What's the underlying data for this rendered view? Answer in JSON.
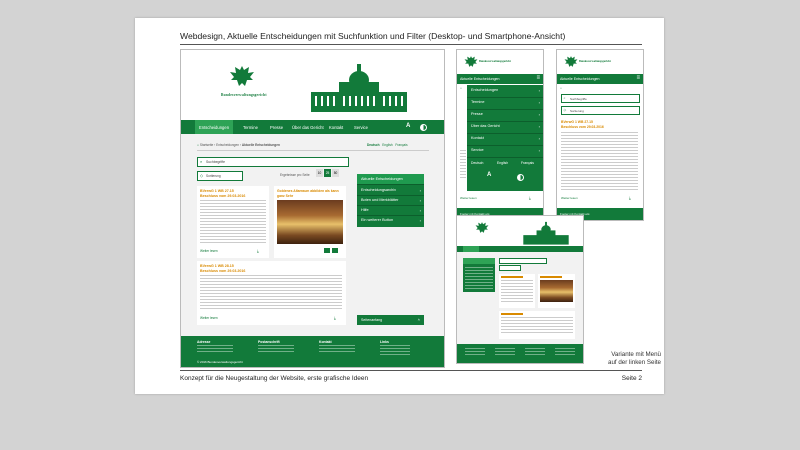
{
  "slide": {
    "title": "Webdesign, Aktuelle Entscheidungen mit Suchfunktion und Filter (Desktop- und Smartphone-Ansicht)",
    "footer_left": "Konzept für die Neugestaltung der Website, erste grafische Ideen",
    "footer_right": "Seite 2",
    "caption_line1": "Variante mit Menü",
    "caption_line2": "auf der linken Seite"
  },
  "colors": {
    "brand": "#127a3a",
    "accent": "#d98a00",
    "background": "#d3d3d3"
  },
  "desktop": {
    "logo_text": "Bundesverwaltungsgericht",
    "nav": [
      "Entscheidungen",
      "Termine",
      "Presse",
      "Über das Gericht",
      "Kontakt",
      "Service"
    ],
    "breadcrumb": [
      "Startseite",
      "Entscheidungen",
      "Aktuelle Entscheidungen"
    ],
    "languages": [
      "Deutsch",
      "English",
      "Français"
    ],
    "search_placeholder": "Suchbegriffe",
    "filter_label": "Sortierung",
    "per_page_label": "Ergebnisse pro Seite",
    "per_page_options": [
      "10",
      "25",
      "50"
    ],
    "side_menu": [
      "Aktuelle Entscheidungen",
      "Entscheidungsarchiv",
      "Boten und Merkblätter",
      "Hilfe",
      "Ein weiterer Button"
    ],
    "side_bottom": "Seitenanfang",
    "card1_title": "BVerwG 1 WB 27.15",
    "card1_date": "Beschluss vom 29.03.2016",
    "card2_title": "Goldenes Altarraum abbilden als kann ganz Sehr",
    "card3_title": "BVerwG 1 WB 28.15",
    "card3_date": "Beschluss vom 29.03.2016",
    "more_link": "Weiter lesen",
    "footer_cols": [
      "Adresse",
      "Postanschrift",
      "Kontakt",
      "Links"
    ],
    "copyright": "© 2016 Bundesverwaltungsgericht"
  },
  "mobile1": {
    "header": "Aktuelle Entscheidungen",
    "menu": [
      "Entscheidungen",
      "Termine",
      "Presse",
      "Über das Gericht",
      "Kontakt",
      "Service"
    ],
    "languages": [
      "Deutsch",
      "English",
      "Français"
    ],
    "more_link": "Weiter lesen",
    "footer": "Footer mit Kontakt etc."
  },
  "mobile2": {
    "header": "Aktuelle Entscheidungen",
    "search_placeholder": "Suchbegriffe",
    "filter_label": "Sortierung",
    "card_title": "BVerwG 1 WB 27.15",
    "card_date": "Beschluss vom 29.03.2016",
    "more_link": "Weiter lesen",
    "footer": "Footer mit Kontakt etc."
  }
}
